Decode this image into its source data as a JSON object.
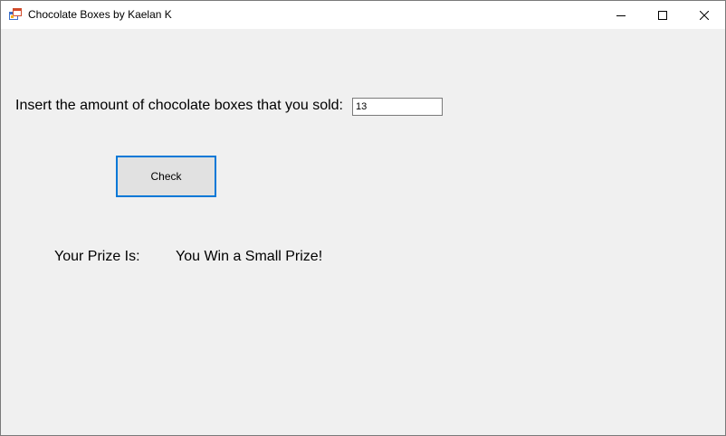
{
  "window": {
    "title": "Chocolate Boxes by Kaelan K",
    "controls": {
      "minimize_icon": "minimize-icon",
      "maximize_icon": "maximize-icon",
      "close_icon": "close-icon"
    },
    "app_icon": "form-app-icon"
  },
  "form": {
    "prompt_label": "Insert the amount of chocolate boxes that you sold:",
    "amount_value": "13",
    "check_button_label": "Check",
    "prize_label": "Your Prize Is:",
    "prize_value": "You Win a Small Prize!"
  },
  "colors": {
    "client_background": "#f0f0f0",
    "titlebar_background": "#ffffff",
    "button_focus_border": "#0078d7",
    "button_background": "#e1e1e1"
  }
}
